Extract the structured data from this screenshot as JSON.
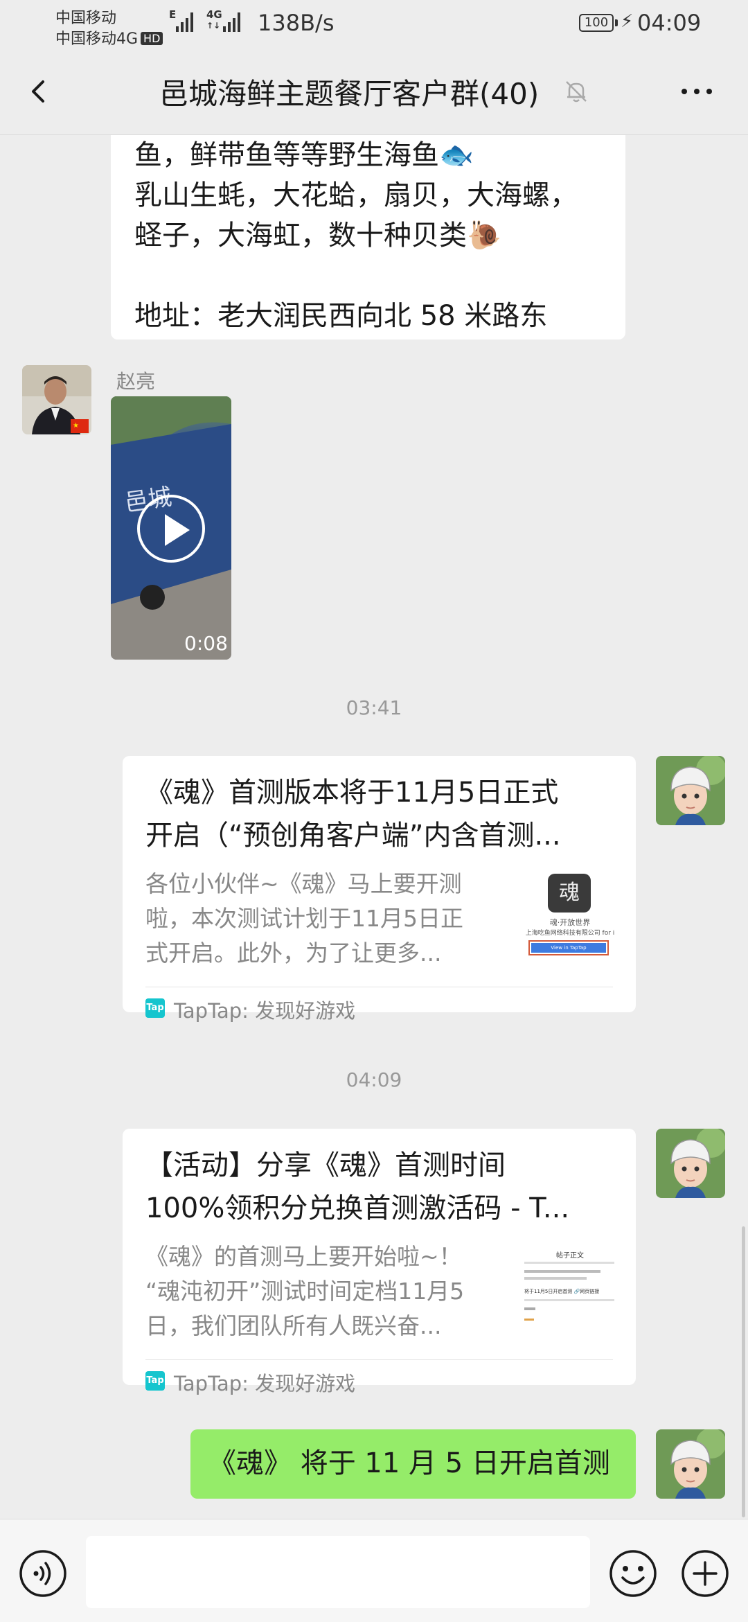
{
  "status_bar": {
    "carrier_1": "中国移动",
    "carrier_2": "中国移动4G",
    "hd_badge": "HD",
    "net_label_top": "E",
    "net_label_4g_1": "4G",
    "net_label_4g_2": "↑↓",
    "network_speed": "138B/s",
    "battery_level": "100",
    "time": "04:09"
  },
  "header": {
    "title": "邑城海鲜主题餐厅客户群(40)",
    "back_icon": "chevron-left-icon",
    "mute_icon": "bell-muted-icon",
    "more_icon": "more-icon"
  },
  "messages": {
    "top_text": {
      "line_1": "鱼，鲜带鱼等等野生海鱼🐟",
      "line_2": "乳山生蚝，大花蛤，扇贝，大海螺，",
      "line_3": "蛏子，大海虹，数十种贝类🐌",
      "line_4": "地址：老大润民西向北 58 米路东"
    },
    "video": {
      "sender": "赵亮",
      "duration": "0:08",
      "play_icon": "play-icon"
    },
    "time_1": "03:41",
    "card_1": {
      "title_1": "《魂》首测版本将于11月5日正式",
      "title_2": "开启（“预创角客户端”内含首测...",
      "desc_1": "各位小伙伴~《魂》马上要开测",
      "desc_2": "啦，本次测试计划于11月5日正",
      "desc_3": "式开启。此外，为了让更多...",
      "thumb_caption_1": "魂·开放世界",
      "thumb_caption_2": "上海吃鱼网络科技有限公司 for i",
      "thumb_button": "View in TapTap",
      "logo_text": "Tap",
      "source": "TapTap: 发现好游戏"
    },
    "time_2": "04:09",
    "card_2": {
      "title_1": "【活动】分享《魂》首测时间",
      "title_2": "100%领积分兑换首测激活码 - T...",
      "desc_1": "《魂》的首测马上要开始啦~！",
      "desc_2": "“魂沌初开”测试时间定档11月5",
      "desc_3": "日，我们团队所有人既兴奋...",
      "thumb_header": "帖子正文",
      "thumb_line": "将于11月5日开启首测 🔗网页链接",
      "logo_text": "Tap",
      "source": "TapTap: 发现好游戏"
    },
    "last_text": "《魂》 将于 11 月 5 日开启首测"
  },
  "input_bar": {
    "voice_icon": "voice-icon",
    "message_placeholder": "",
    "emoji_icon": "emoji-icon",
    "plus_icon": "plus-circle-icon"
  },
  "colors": {
    "background": "#ededed",
    "sent_bubble": "#95ec69",
    "received_bubble": "#ffffff",
    "taptap_brand": "#15c5ce"
  }
}
